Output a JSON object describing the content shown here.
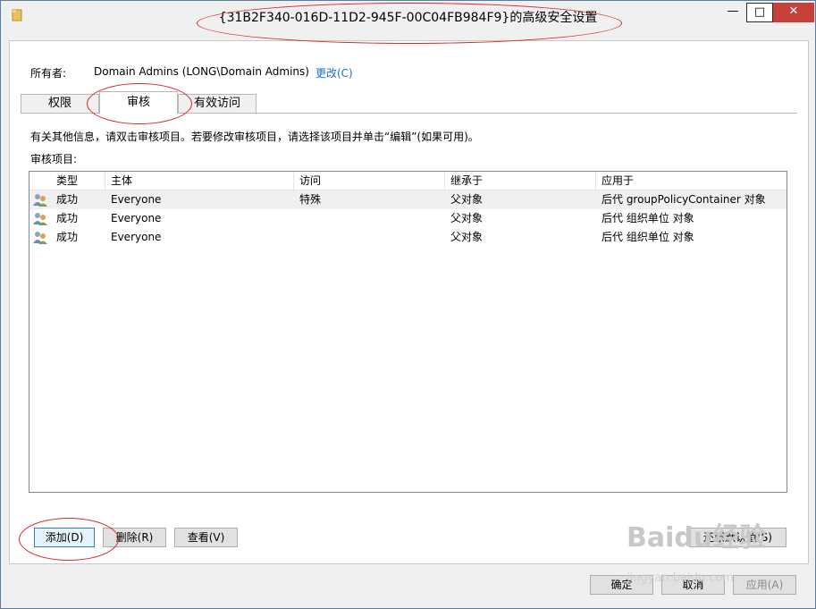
{
  "window": {
    "title": "{31B2F340-016D-11D2-945F-00C04FB984F9}的高级安全设置",
    "minimize_glyph": "—",
    "maximize_glyph": "□",
    "close_glyph": "✕"
  },
  "owner": {
    "label": "所有者:",
    "value": "Domain Admins (LONG\\Domain Admins)",
    "change_link": "更改(C)"
  },
  "tabs": [
    {
      "label": "权限",
      "active": false
    },
    {
      "label": "审核",
      "active": true
    },
    {
      "label": "有效访问",
      "active": false
    }
  ],
  "audit": {
    "info_text": "有关其他信息，请双击审核项目。若要修改审核项目，请选择该项目并单击“编辑”(如果可用)。",
    "entries_label": "审核项目:",
    "columns": [
      "类型",
      "主体",
      "访问",
      "继承于",
      "应用于"
    ],
    "rows": [
      {
        "type": "成功",
        "principal": "Everyone",
        "access": "特殊",
        "inherited_from": "父对象",
        "applies_to": "后代 groupPolicyContainer 对象",
        "icon": "users-icon"
      },
      {
        "type": "成功",
        "principal": "Everyone",
        "access": "",
        "inherited_from": "父对象",
        "applies_to": "后代 组织单位 对象",
        "icon": "users-icon"
      },
      {
        "type": "成功",
        "principal": "Everyone",
        "access": "",
        "inherited_from": "父对象",
        "applies_to": "后代 组织单位 对象",
        "icon": "users-icon"
      }
    ]
  },
  "buttons": {
    "add": "添加(D)",
    "remove": "删除(R)",
    "view": "查看(V)",
    "restore_defaults": "还原默认值(S)",
    "ok": "确定",
    "cancel": "取消",
    "apply": "应用(A)"
  },
  "watermark": {
    "brand": "Baidu经验",
    "url": "jingyan.baidu.com"
  },
  "colors": {
    "annotation_red": "#d8262a",
    "close_button": "#c7413a",
    "link_blue": "#1e6fc3",
    "window_border": "#5a7da6"
  }
}
